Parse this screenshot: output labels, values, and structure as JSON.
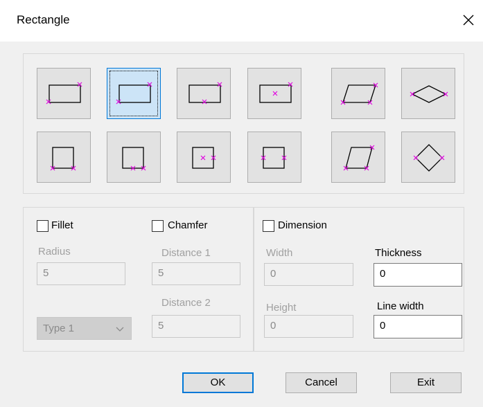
{
  "window": {
    "title": "Rectangle",
    "close_icon": "close-icon"
  },
  "shapes": {
    "selected_index": 1,
    "accent_color": "#e000e0",
    "row1": [
      {
        "name": "rect-corner-points"
      },
      {
        "name": "rect-corners-center-dotted"
      },
      {
        "name": "rect-corner-bottom-mid"
      },
      {
        "name": "rect-center-corner"
      },
      {
        "name": "parallelogram-three-points"
      },
      {
        "name": "rhombus-horizontal"
      }
    ],
    "row2": [
      {
        "name": "square-bottom-points"
      },
      {
        "name": "square-bottom-mid-points"
      },
      {
        "name": "square-center-side"
      },
      {
        "name": "square-side-points"
      },
      {
        "name": "parallelogram-square"
      },
      {
        "name": "diamond-square"
      }
    ]
  },
  "fillet": {
    "label": "Fillet",
    "checked": false,
    "radius_label": "Radius",
    "radius_value": "5",
    "type_value": "Type 1"
  },
  "chamfer": {
    "label": "Chamfer",
    "checked": false,
    "distance1_label": "Distance 1",
    "distance1_value": "5",
    "distance2_label": "Distance 2",
    "distance2_value": "5"
  },
  "dimension": {
    "label": "Dimension",
    "checked": false,
    "width_label": "Width",
    "width_value": "0",
    "height_label": "Height",
    "height_value": "0"
  },
  "thickness": {
    "label": "Thickness",
    "value": "0"
  },
  "line_width": {
    "label": "Line width",
    "value": "0"
  },
  "buttons": {
    "ok": "OK",
    "cancel": "Cancel",
    "exit": "Exit"
  }
}
